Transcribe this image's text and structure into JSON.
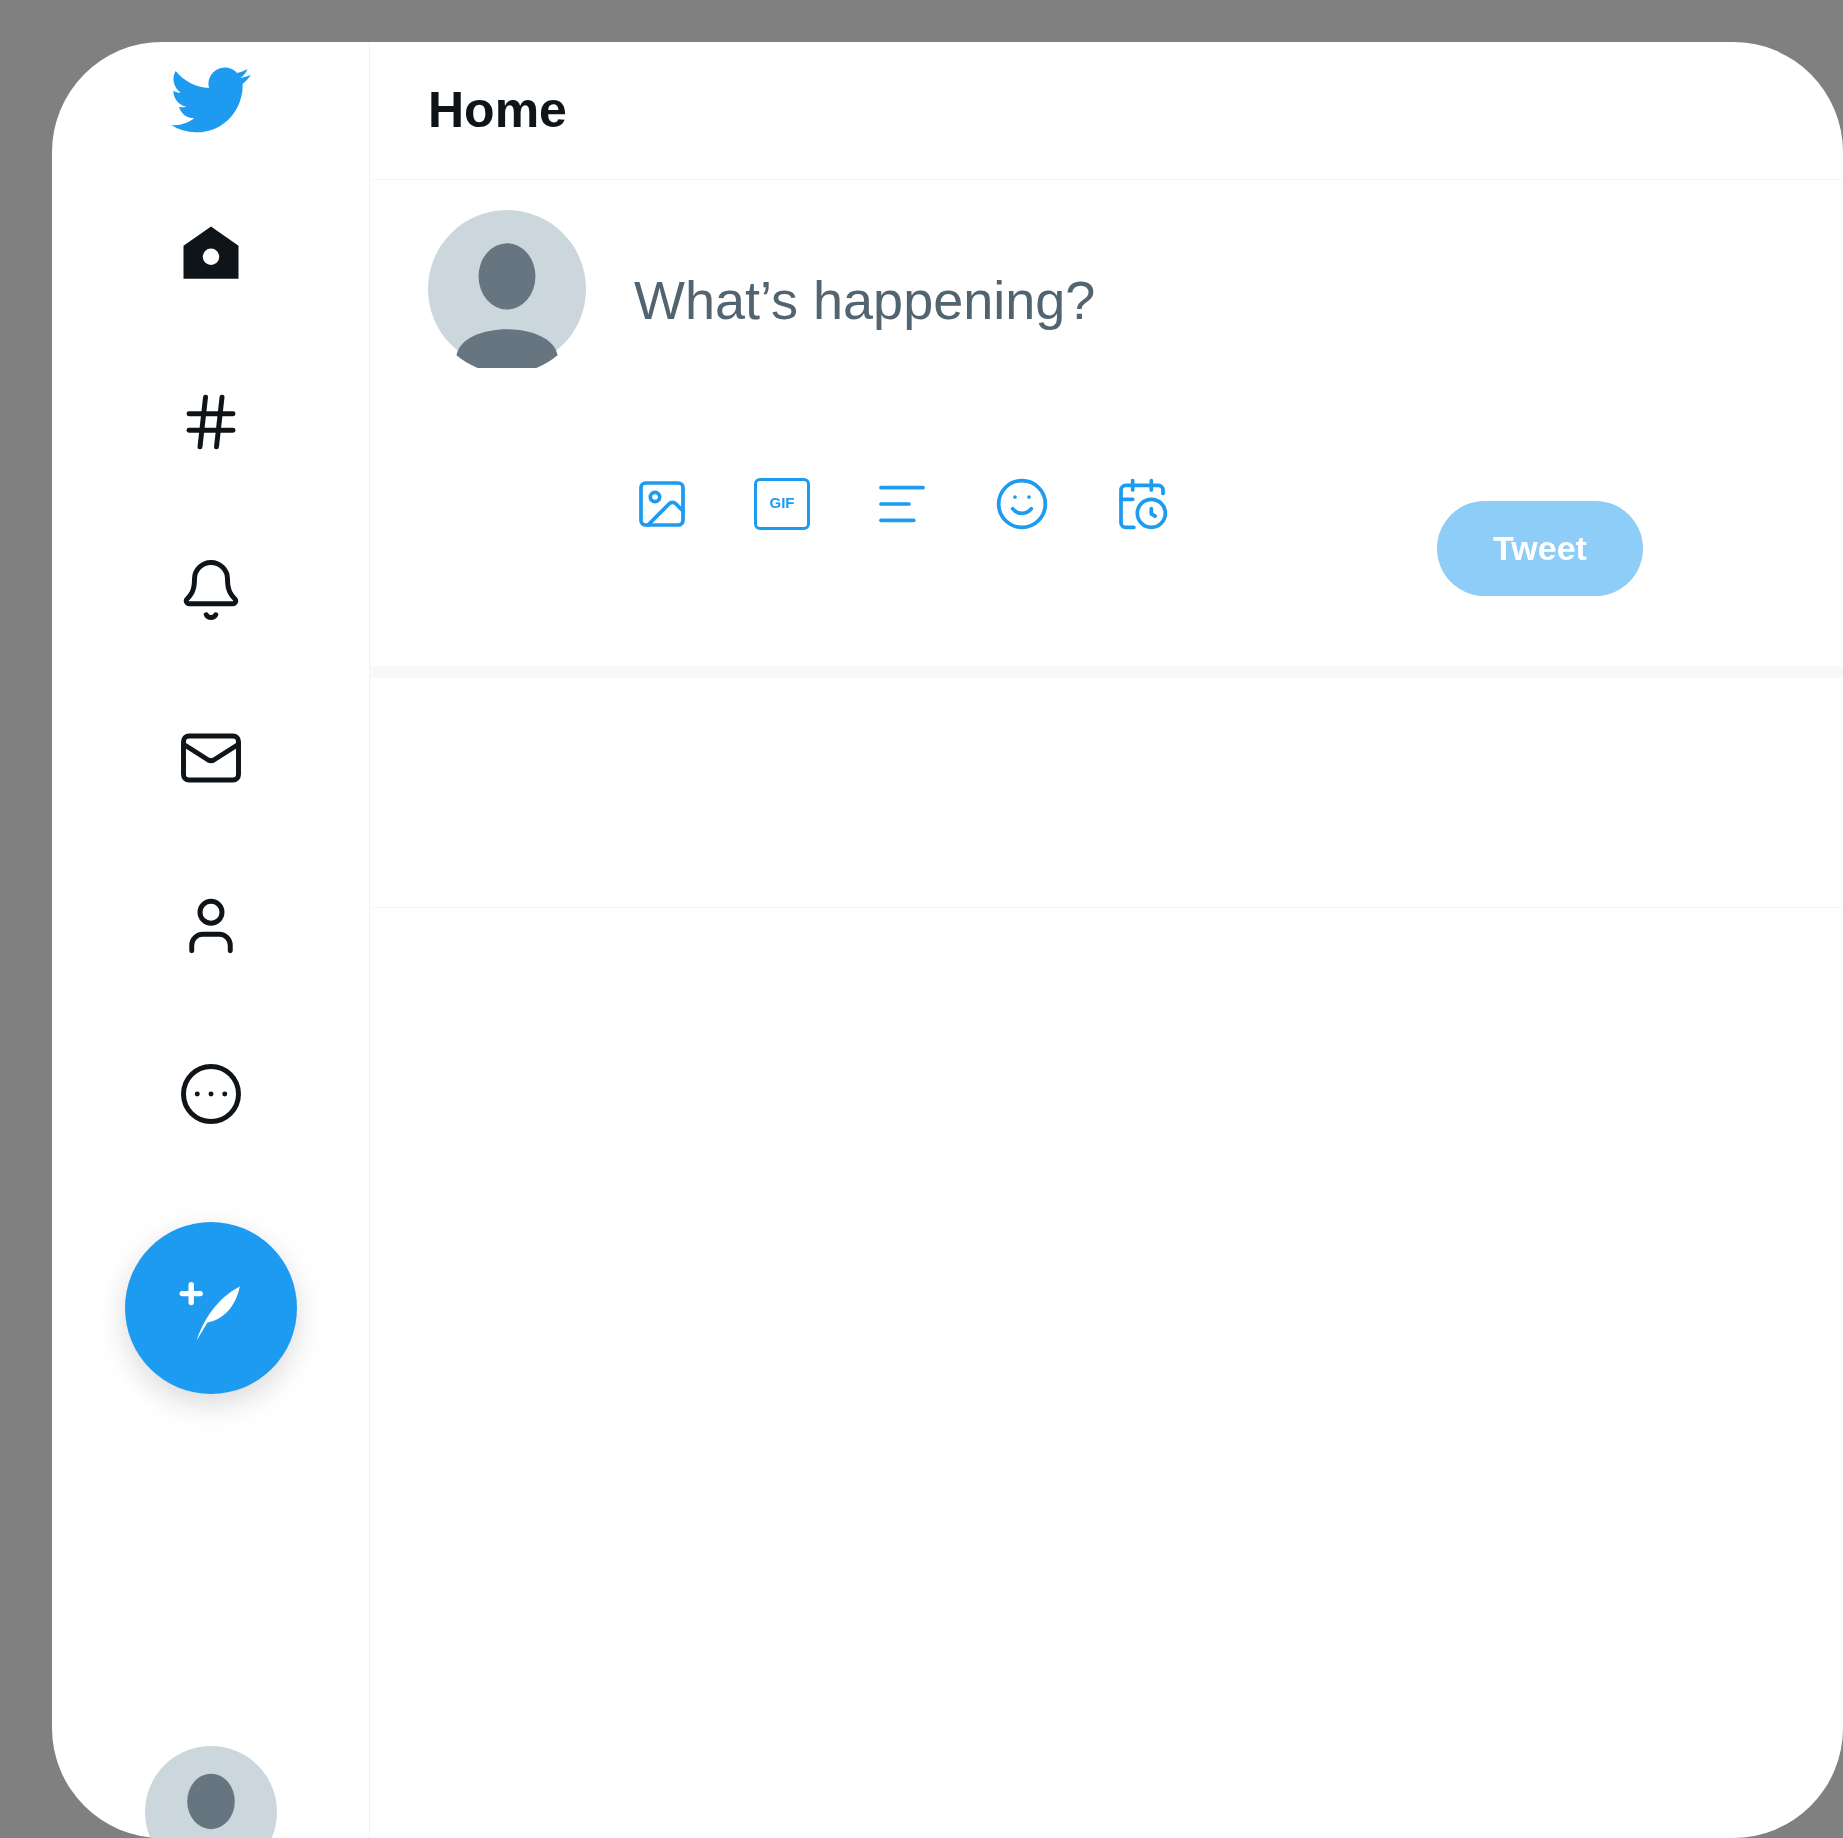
{
  "header": {
    "title": "Home"
  },
  "nav": [
    {
      "kind": "home",
      "selected": true
    },
    {
      "kind": "explore",
      "selected": false
    },
    {
      "kind": "notifications",
      "selected": false
    },
    {
      "kind": "messages",
      "selected": false
    },
    {
      "kind": "profile",
      "selected": false
    },
    {
      "kind": "more",
      "selected": false
    }
  ],
  "composer": {
    "placeholder": "What’s happening?",
    "tools": [
      {
        "kind": "media"
      },
      {
        "kind": "gif",
        "label": "GIF"
      },
      {
        "kind": "poll"
      },
      {
        "kind": "emoji"
      },
      {
        "kind": "schedule"
      }
    ],
    "tweet_button": {
      "label": "Tweet",
      "disabled": true
    }
  }
}
